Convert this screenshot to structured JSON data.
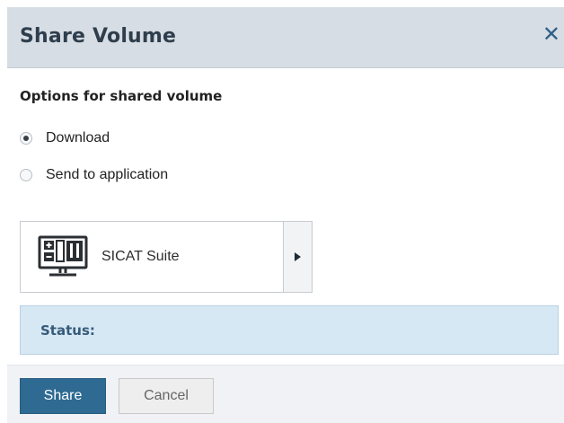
{
  "dialog": {
    "title": "Share Volume",
    "close_icon": "close-icon"
  },
  "options": {
    "section_title": "Options for shared volume",
    "items": [
      {
        "label": "Download",
        "selected": true
      },
      {
        "label": "Send to application",
        "selected": false
      }
    ]
  },
  "application": {
    "label": "SICAT Suite",
    "icon": "monitor-app-icon",
    "arrow_icon": "chevron-right-icon"
  },
  "status": {
    "label": "Status:"
  },
  "footer": {
    "share_label": "Share",
    "cancel_label": "Cancel"
  },
  "colors": {
    "header_bg": "#d6dde4",
    "primary_button": "#2e6a92",
    "status_bg": "#d7e8f5",
    "close_icon": "#2f5f86"
  }
}
